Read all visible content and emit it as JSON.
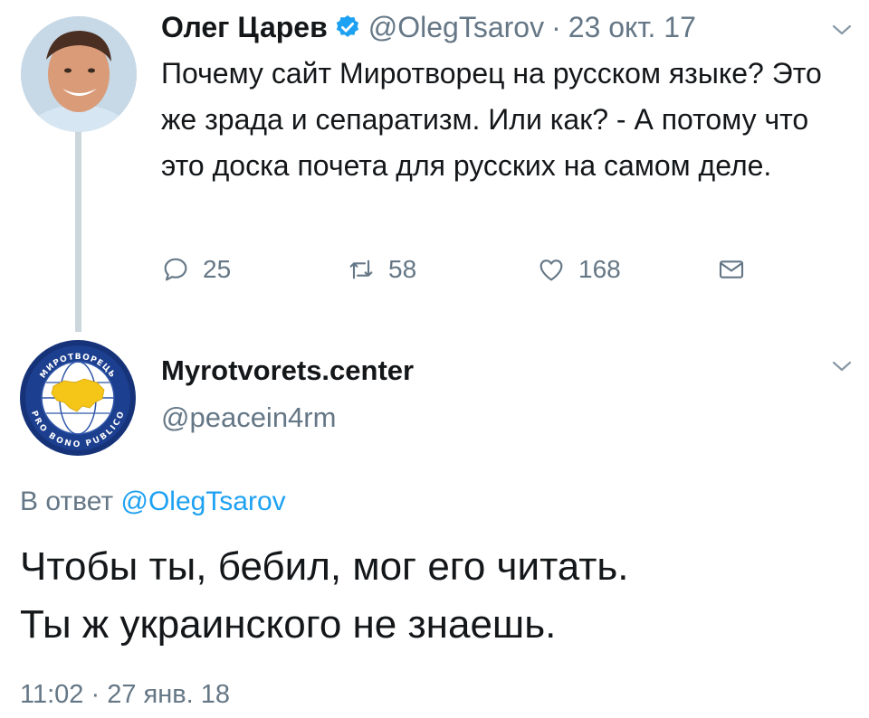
{
  "tweet1": {
    "name": "Олег Царев",
    "handle": "@OlegTsarov",
    "separator": "·",
    "date": "23 окт. 17",
    "text": "Почему сайт Миротворец на русском языке? Это же зрада и сепаратизм. Или как? - А потому что это доска почета для русских на самом деле.",
    "actions": {
      "replies": "25",
      "retweets": "58",
      "likes": "168"
    }
  },
  "tweet2": {
    "name": "Myrotvorets.center",
    "handle": "@peacein4rm",
    "avatar_text_top": "МИРОТВОРЕЦЬ",
    "avatar_text_bottom": "PRO BONO PUBLICO",
    "reply_prefix": "В ответ",
    "reply_mention": "@OlegTsarov",
    "text_line1": "Чтобы ты, бебил, мог его читать.",
    "text_line2": "Ты ж украинского не знаешь.",
    "timestamp": "11:02 · 27 янв. 18"
  },
  "colors": {
    "text": "#14171a",
    "secondary": "#657786",
    "link": "#1da1f2",
    "verified": "#1da1f2",
    "thread_line": "#ccd6dd"
  },
  "icons": [
    "verified-badge-icon",
    "chevron-down-icon",
    "reply-icon",
    "retweet-icon",
    "like-icon",
    "direct-message-icon"
  ]
}
